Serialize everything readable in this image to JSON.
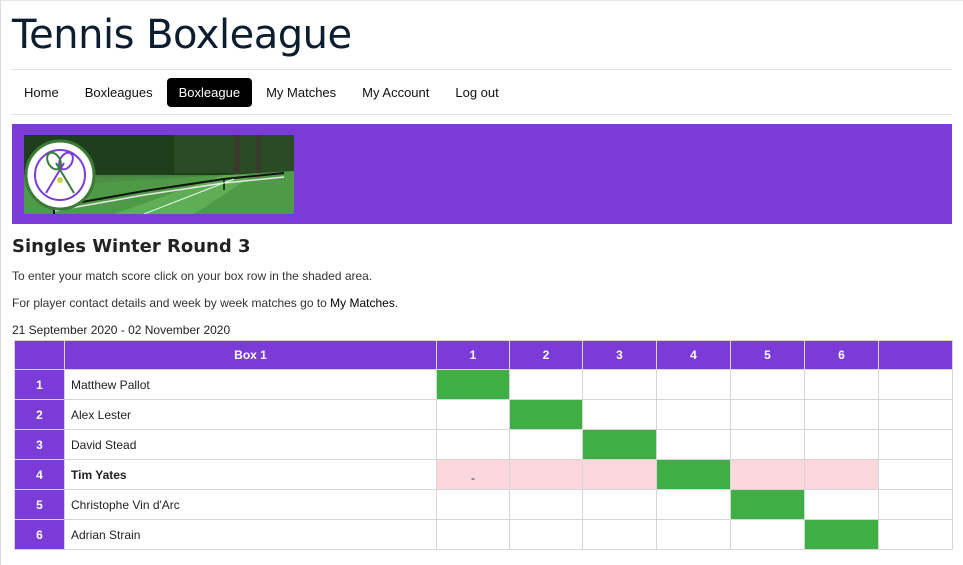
{
  "site": {
    "title": "Tennis Boxleague"
  },
  "nav": {
    "items": [
      {
        "label": "Home",
        "active": false
      },
      {
        "label": "Boxleagues",
        "active": false
      },
      {
        "label": "Boxleague",
        "active": true
      },
      {
        "label": "My Matches",
        "active": false
      },
      {
        "label": "My Account",
        "active": false
      },
      {
        "label": "Log out",
        "active": false
      }
    ]
  },
  "banner": {
    "background": "#7b3bd6"
  },
  "page": {
    "round_title": "Singles Winter Round 3",
    "instructions": "To enter your match score click on your box row in the shaded area.",
    "contact_text": "For player contact details and week by week matches go to ",
    "contact_link": "My Matches",
    "contact_end": ".",
    "date_range": "21 September 2020 - 02 November 2020"
  },
  "table": {
    "box_header": "Box 1",
    "column_numbers": [
      "1",
      "2",
      "3",
      "4",
      "5",
      "6"
    ],
    "rows": [
      {
        "num": "1",
        "name": "Matthew Pallot",
        "bold": false,
        "highlight": false,
        "cells": [
          "",
          "",
          "",
          "",
          "",
          ""
        ]
      },
      {
        "num": "2",
        "name": "Alex Lester",
        "bold": false,
        "highlight": false,
        "cells": [
          "",
          "",
          "",
          "",
          "",
          ""
        ]
      },
      {
        "num": "3",
        "name": "David Stead",
        "bold": false,
        "highlight": false,
        "cells": [
          "",
          "",
          "",
          "",
          "",
          ""
        ]
      },
      {
        "num": "4",
        "name": "Tim Yates",
        "bold": true,
        "highlight": true,
        "cells": [
          "-",
          "",
          "",
          "",
          "",
          ""
        ]
      },
      {
        "num": "5",
        "name": "Christophe Vin d'Arc",
        "bold": false,
        "highlight": false,
        "cells": [
          "",
          "",
          "",
          "",
          "",
          ""
        ]
      },
      {
        "num": "6",
        "name": "Adrian Strain",
        "bold": false,
        "highlight": false,
        "cells": [
          "",
          "",
          "",
          "",
          "",
          ""
        ]
      }
    ],
    "colors": {
      "header": "#7b3bd6",
      "self_match": "#3fae45",
      "my_row": "#fcd8dc"
    }
  }
}
